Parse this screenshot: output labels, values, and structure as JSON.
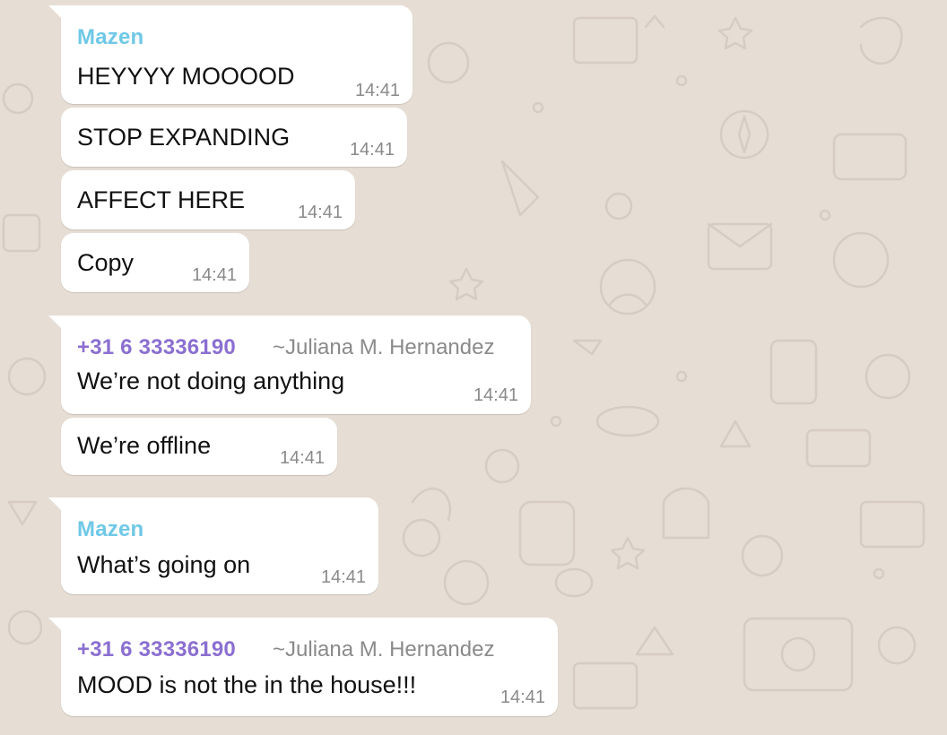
{
  "chat": {
    "theme": {
      "background": "#e6ddd4",
      "bubble": "#ffffff",
      "sender_mazen_color": "#6fc8e6",
      "sender_phone_color": "#8b6fd1",
      "time_color": "#8a8a8a"
    },
    "groups": [
      {
        "sender": "Mazen",
        "alias": "",
        "messages": [
          {
            "text": "HEYYYY MOOOOD",
            "time": "14:41"
          },
          {
            "text": "STOP EXPANDING",
            "time": "14:41"
          },
          {
            "text": "AFFECT HERE",
            "time": "14:41"
          },
          {
            "text": "Copy",
            "time": "14:41"
          }
        ]
      },
      {
        "sender": "+31 6 33336190",
        "alias": "~Juliana M. Hernandez",
        "messages": [
          {
            "text": "We’re not doing anything",
            "time": "14:41"
          },
          {
            "text": "We’re offline",
            "time": "14:41"
          }
        ]
      },
      {
        "sender": "Mazen",
        "alias": "",
        "messages": [
          {
            "text": "What’s going on",
            "time": "14:41"
          }
        ]
      },
      {
        "sender": "+31 6 33336190",
        "alias": "~Juliana M. Hernandez",
        "messages": [
          {
            "text": "MOOD is not the in the house!!!",
            "time": "14:41"
          }
        ]
      }
    ]
  }
}
